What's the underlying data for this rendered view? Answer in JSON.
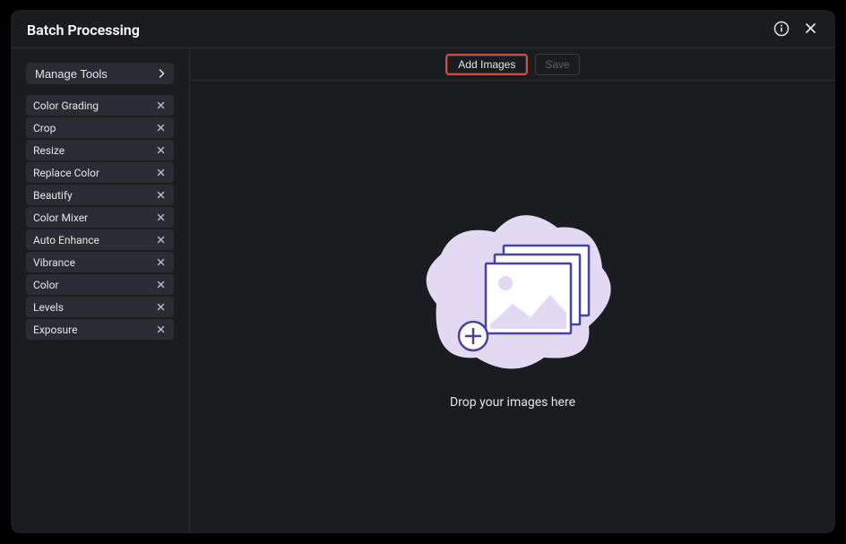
{
  "header": {
    "title": "Batch Processing"
  },
  "sidebar": {
    "manage_tools_label": "Manage Tools",
    "tools": [
      {
        "label": "Color Grading"
      },
      {
        "label": "Crop"
      },
      {
        "label": "Resize"
      },
      {
        "label": "Replace Color"
      },
      {
        "label": "Beautify"
      },
      {
        "label": "Color Mixer"
      },
      {
        "label": "Auto Enhance"
      },
      {
        "label": "Vibrance"
      },
      {
        "label": "Color"
      },
      {
        "label": "Levels"
      },
      {
        "label": "Exposure"
      }
    ]
  },
  "toolbar": {
    "add_images_label": "Add Images",
    "save_label": "Save"
  },
  "dropzone": {
    "text": "Drop your images here"
  },
  "colors": {
    "highlight": "#d94a3e",
    "panel": "#1b1c20",
    "item": "#2b2c33",
    "text": "#e5e5e8",
    "muted": "#60616a",
    "border": "#2f3036",
    "illustration_fill": "#e3d9f2",
    "illustration_stroke": "#4a42a3"
  }
}
